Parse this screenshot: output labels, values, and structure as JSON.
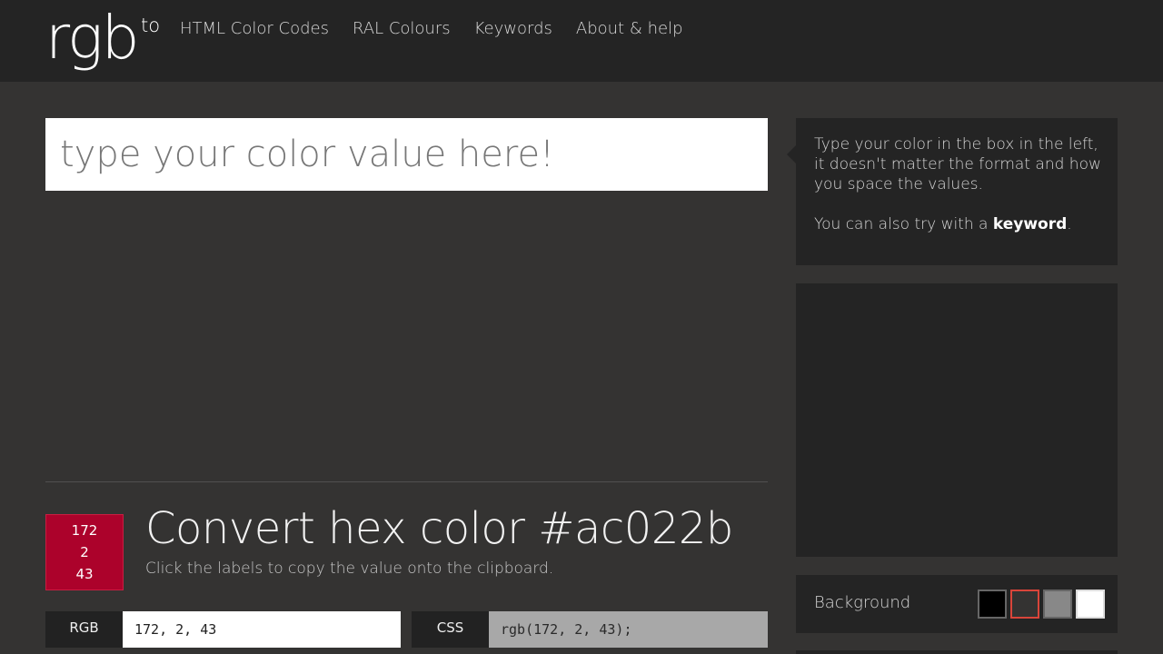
{
  "header": {
    "logo_main": "rgb",
    "logo_sup": "to",
    "nav": [
      {
        "label": "HTML Color Codes"
      },
      {
        "label": "RAL Colours"
      },
      {
        "label": "Keywords"
      },
      {
        "label": "About & help"
      }
    ]
  },
  "search": {
    "placeholder": "type your color value here!"
  },
  "result": {
    "swatch_color": "#ac022b",
    "r": "172",
    "g": "2",
    "b": "43",
    "title": "Convert hex color #ac022b",
    "subtitle": "Click the labels to copy the value onto the clipboard."
  },
  "fields": [
    {
      "label": "RGB",
      "value": "172, 2, 43"
    },
    {
      "label": "CSS",
      "value": "rgb(172, 2, 43);"
    }
  ],
  "info": {
    "line1": "Type your color in the box in the left, it doesn't matter the format and how you space the values.",
    "line2_prefix": "You can also try with a ",
    "line2_keyword": "keyword",
    "line2_suffix": "."
  },
  "background_panel": {
    "label": "Background",
    "options": [
      {
        "color": "#000000"
      },
      {
        "color": "#343332",
        "selected": true
      },
      {
        "color": "#888888"
      },
      {
        "color": "#ffffff"
      }
    ]
  }
}
